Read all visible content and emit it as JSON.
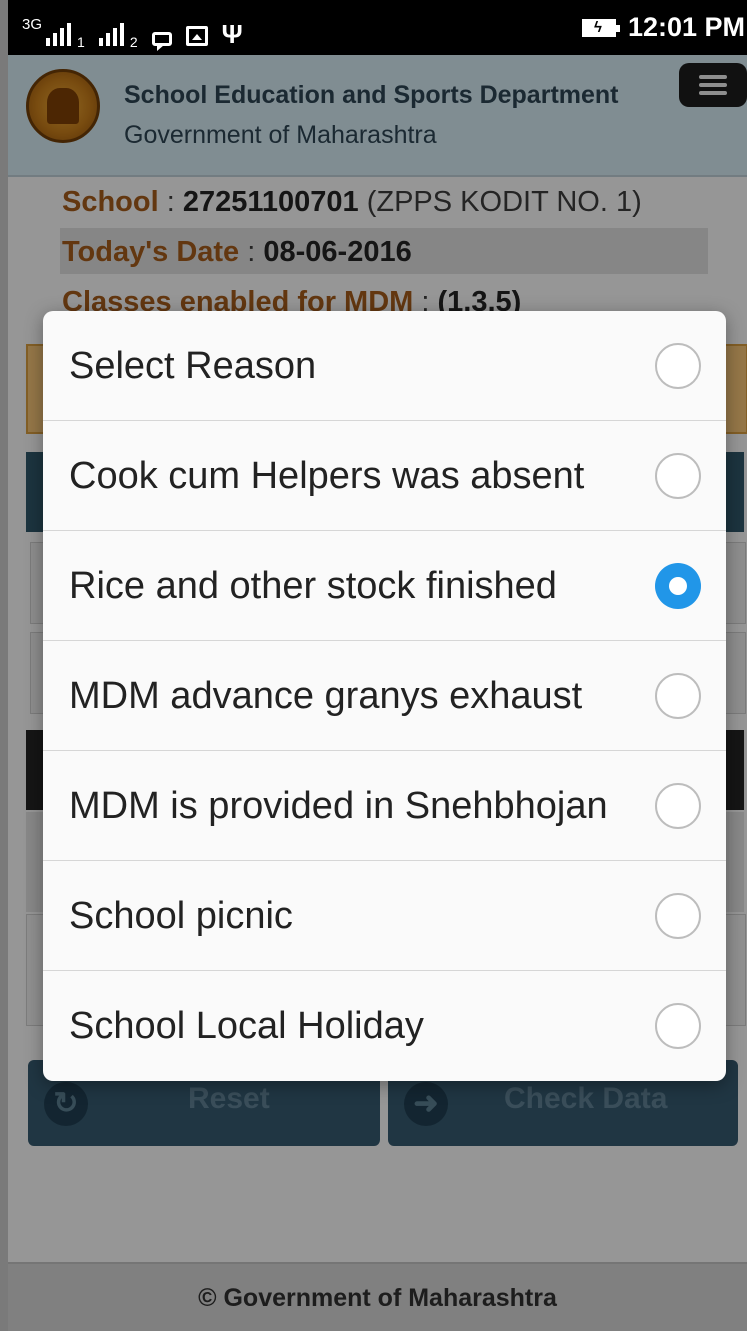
{
  "status_bar": {
    "network": "3G",
    "sim1": "1",
    "sim2": "2",
    "time": "12:01 PM",
    "icons": [
      "signal-icon",
      "message-icon",
      "image-icon",
      "usb-icon",
      "battery-charging-icon"
    ]
  },
  "header": {
    "title": "School Education and Sports Department",
    "subtitle": "Government of Maharashtra"
  },
  "school_info": {
    "school_label": "School",
    "school_sep": " : ",
    "school_code": "27251100701",
    "school_name": "(ZPPS KODIT NO. 1)",
    "date_label": "Today's Date",
    "date_sep": " : ",
    "date_value": "08-06-2016",
    "classes_label": "Classes enabled for MDM",
    "classes_sep": " : ",
    "classes_value": "(1,3,5)"
  },
  "dialog": {
    "options": [
      {
        "label": "Select Reason",
        "selected": false
      },
      {
        "label": "Cook cum Helpers was absent",
        "selected": false
      },
      {
        "label": "Rice and other stock finished",
        "selected": true
      },
      {
        "label": "MDM advance granys exhaust",
        "selected": false
      },
      {
        "label": "MDM is provided in Snehbhojan",
        "selected": false
      },
      {
        "label": "School picnic",
        "selected": false
      },
      {
        "label": "School Local Holiday",
        "selected": false
      }
    ]
  },
  "buttons": {
    "reset": "Reset",
    "check_data": "Check Data"
  },
  "footer": {
    "text": "© Government of Maharashtra"
  },
  "colors": {
    "accent": "#2196e8",
    "header_bg": "#cfe4ec",
    "button_bg": "#34586c"
  }
}
